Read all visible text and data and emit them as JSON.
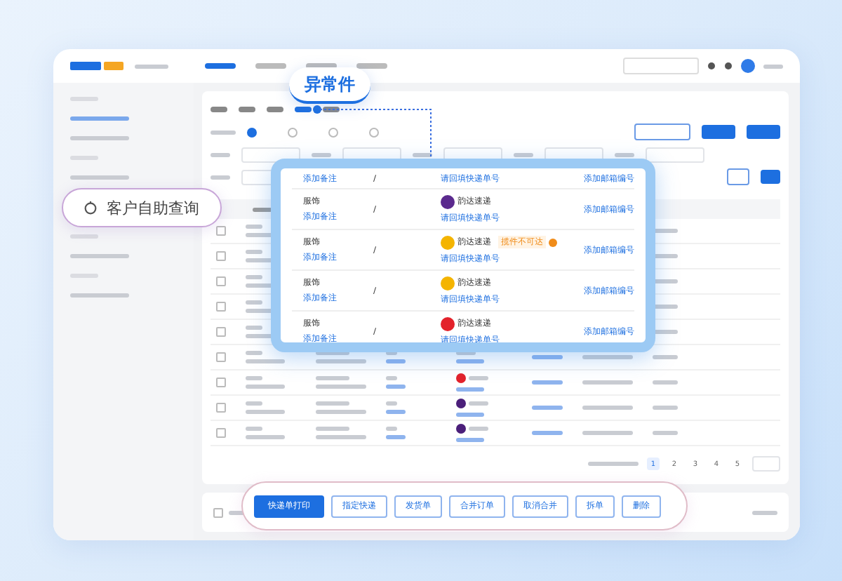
{
  "nav_tabs": [
    {
      "selected": true
    },
    {
      "selected": false
    },
    {
      "selected": false
    },
    {
      "selected": false
    }
  ],
  "filter_tabs": [
    {
      "selected": false
    },
    {
      "selected": false
    },
    {
      "selected": false
    },
    {
      "selected": true
    },
    {
      "selected": false
    }
  ],
  "radios": [
    {
      "selected": true
    },
    {
      "selected": false
    },
    {
      "selected": false
    },
    {
      "selected": false
    }
  ],
  "highlight_tab": {
    "label": "异常件"
  },
  "self_service": {
    "label": "客户自助查询"
  },
  "popup": {
    "rows": [
      {
        "kind": "partial",
        "note_link": "添加备注",
        "separator": "/",
        "tracking_link": "请回填快递单号",
        "action": "添加邮箱编号"
      },
      {
        "kind": "full",
        "category": "服饰",
        "note_link": "添加备注",
        "separator": "/",
        "courier": "韵达速递",
        "color": "#5b2a8e",
        "tracking_link": "请回填快递单号",
        "action": "添加邮箱编号"
      },
      {
        "kind": "full",
        "category": "服饰",
        "note_link": "添加备注",
        "separator": "/",
        "courier": "韵达速递",
        "color": "#f4b400",
        "warning": "揽件不可达",
        "tracking_link": "请回填快递单号",
        "action": "添加邮箱编号"
      },
      {
        "kind": "full",
        "category": "服饰",
        "note_link": "添加备注",
        "separator": "/",
        "courier": "韵达速递",
        "color": "#f4b400",
        "tracking_link": "请回填快递单号",
        "action": "添加邮箱编号"
      },
      {
        "kind": "full",
        "category": "服饰",
        "note_link": "添加备注",
        "separator": "/",
        "courier": "韵达速递",
        "color": "#e3222b",
        "tracking_link": "请回填快递单号",
        "action": "添加邮箱编号"
      }
    ]
  },
  "table": {
    "rows": [
      {
        "checked": false
      },
      {
        "checked": false
      },
      {
        "checked": false
      },
      {
        "checked": false
      },
      {
        "checked": false
      },
      {
        "checked": false
      },
      {
        "checked": false,
        "color": "#e3222b"
      },
      {
        "checked": false,
        "color": "#4b1f7a"
      },
      {
        "checked": false,
        "color": "#4b1f7a"
      }
    ]
  },
  "pagination": {
    "pages": [
      {
        "label": "1",
        "selected": true
      },
      {
        "label": "2",
        "selected": false
      },
      {
        "label": "3",
        "selected": false
      },
      {
        "label": "4",
        "selected": false
      },
      {
        "label": "5",
        "selected": false
      }
    ]
  },
  "select_all": {
    "checked": false
  },
  "actions": [
    {
      "label": "快递单打印",
      "primary": true
    },
    {
      "label": "指定快递",
      "primary": false
    },
    {
      "label": "发货单",
      "primary": false
    },
    {
      "label": "合并订单",
      "primary": false
    },
    {
      "label": "取消合并",
      "primary": false
    },
    {
      "label": "拆单",
      "primary": false
    },
    {
      "label": "删除",
      "primary": false
    }
  ]
}
